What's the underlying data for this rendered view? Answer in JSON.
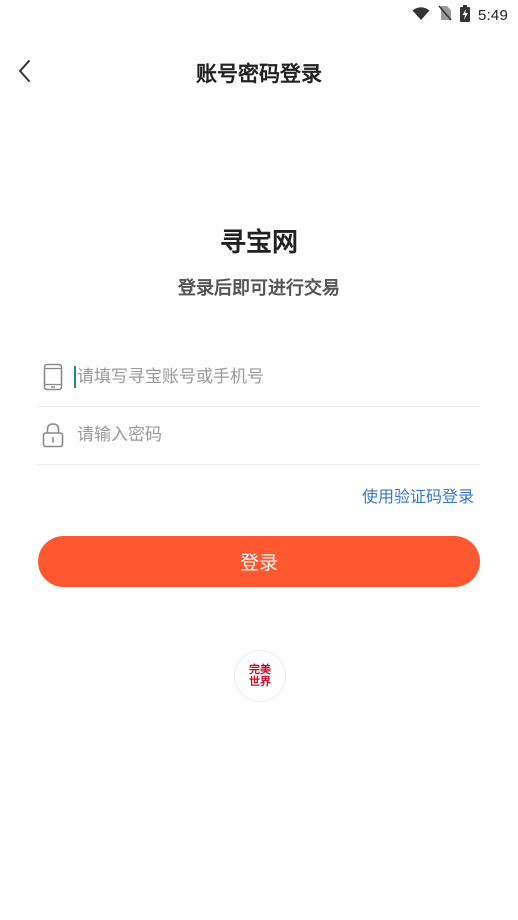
{
  "status_bar": {
    "time": "5:49",
    "icons": [
      "wifi-icon",
      "no-sim-icon",
      "battery-charging-icon"
    ]
  },
  "header": {
    "title": "账号密码登录",
    "back_icon": "chevron-left-icon"
  },
  "brand": {
    "title": "寻宝网",
    "subtitle": "登录后即可进行交易"
  },
  "form": {
    "account": {
      "placeholder": "请填写寻宝账号或手机号",
      "value": "",
      "icon": "phone-icon"
    },
    "password": {
      "placeholder": "请输入密码",
      "value": "",
      "icon": "lock-icon"
    },
    "sms_login_link": "使用验证码登录",
    "login_button": "登录"
  },
  "third_party": {
    "logo_line1": "完美",
    "logo_line2": "世界"
  },
  "colors": {
    "accent": "#ff5730",
    "link": "#3a78c9",
    "logo": "#c8102e"
  }
}
